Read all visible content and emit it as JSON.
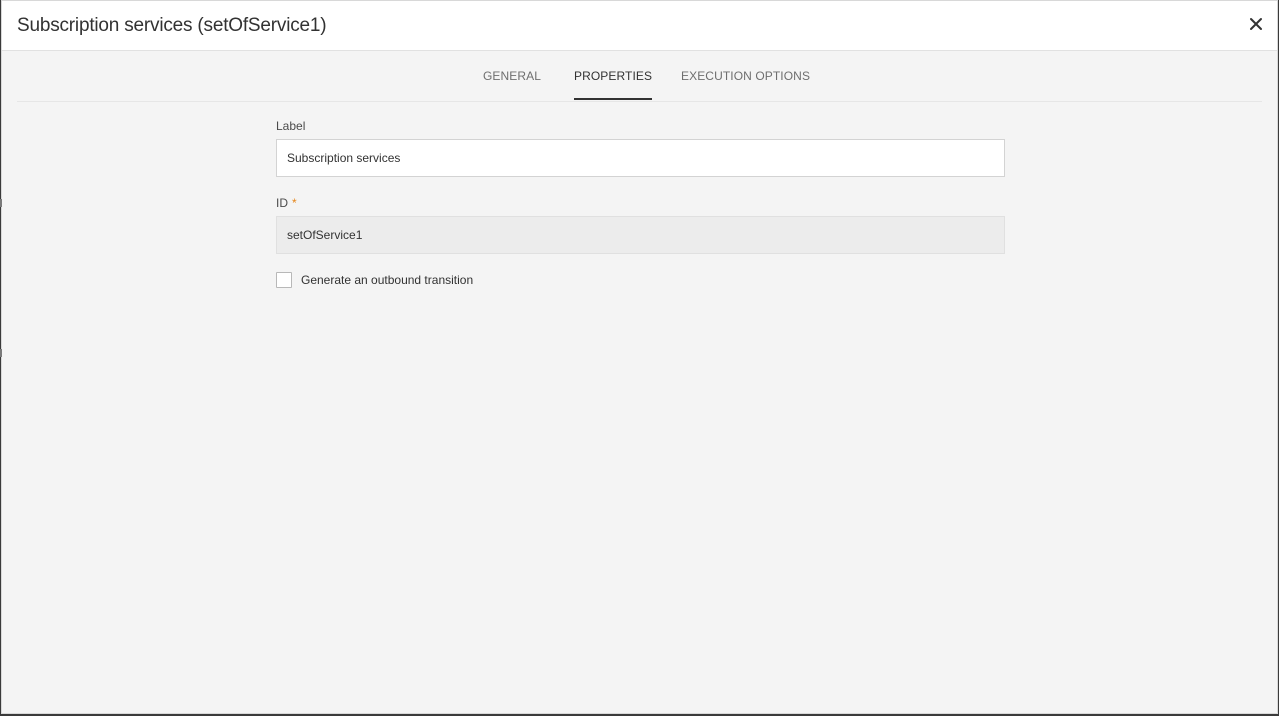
{
  "dialog": {
    "title": "Subscription services (setOfService1)"
  },
  "tabs": [
    {
      "label": "GENERAL",
      "active": false
    },
    {
      "label": "PROPERTIES",
      "active": true
    },
    {
      "label": "EXECUTION OPTIONS",
      "active": false
    }
  ],
  "form": {
    "label_field": {
      "label": "Label",
      "value": "Subscription services"
    },
    "id_field": {
      "label": "ID",
      "required_marker": "*",
      "value": "setOfService1"
    },
    "outbound_checkbox": {
      "label": "Generate an outbound transition",
      "checked": false
    }
  },
  "icons": {
    "close": "close-icon"
  },
  "colors": {
    "background": "#f4f4f4",
    "header": "#ffffff",
    "active_tab_underline": "#323232",
    "required_marker": "#e68619"
  }
}
